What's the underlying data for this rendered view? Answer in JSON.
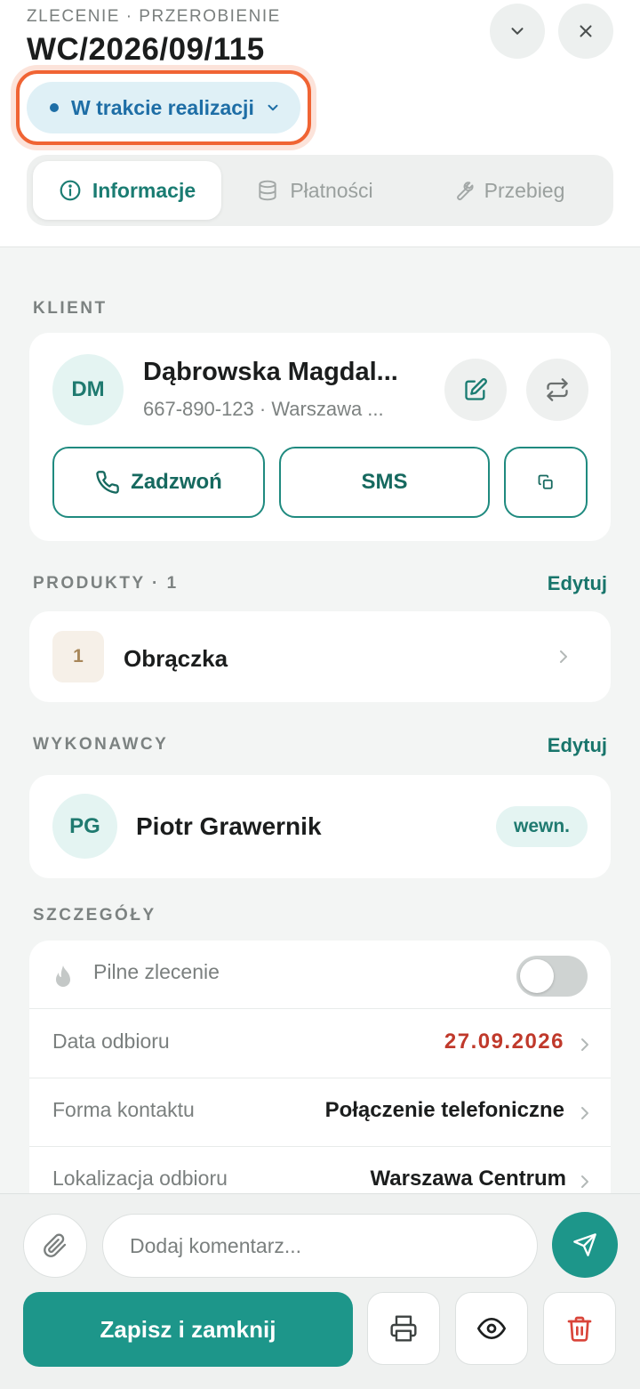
{
  "header": {
    "eyebrow": "ZLECENIE · PRZEROBIENIE",
    "order_number": "WC/2026/09/115",
    "status": "W trakcie realizacji",
    "collapse_icon": "chevron-down-icon",
    "close_icon": "close-icon"
  },
  "tabs": [
    {
      "label": "Informacje",
      "icon": "info-icon",
      "active": true
    },
    {
      "label": "Płatności",
      "icon": "database-icon",
      "active": false
    },
    {
      "label": "Przebieg",
      "icon": "wrench-icon",
      "active": false
    }
  ],
  "client": {
    "section_label": "KLIENT",
    "initials": "DM",
    "name": "Dąbrowska Magdal...",
    "details": "667-890-123 · Warszawa ...",
    "call_label": "Zadzwoń",
    "sms_label": "SMS"
  },
  "products": {
    "section_label": "PRODUKTY · 1",
    "edit_label": "Edytuj",
    "items": [
      {
        "qty": "1",
        "name": "Obrączka"
      }
    ]
  },
  "workers": {
    "section_label": "WYKONAWCY",
    "edit_label": "Edytuj",
    "items": [
      {
        "initials": "PG",
        "name": "Piotr Grawernik",
        "badge": "wewn."
      }
    ]
  },
  "details": {
    "section_label": "SZCZEGÓŁY",
    "urgent_label": "Pilne zlecenie",
    "urgent_on": false,
    "pickup_date_label": "Data odbioru",
    "pickup_date_value": "27.09.2026",
    "contact_label": "Forma kontaktu",
    "contact_value": "Połączenie telefoniczne",
    "location_label": "Lokalizacja odbioru",
    "location_value": "Warszawa Centrum"
  },
  "footer": {
    "comment_placeholder": "Dodaj komentarz...",
    "save_label": "Zapisz i zamknij"
  },
  "colors": {
    "accent": "#1d968a",
    "status_blue": "#1e6ea6",
    "highlight": "#f06434",
    "date_red": "#c0392b",
    "delete_red": "#d9453a"
  }
}
